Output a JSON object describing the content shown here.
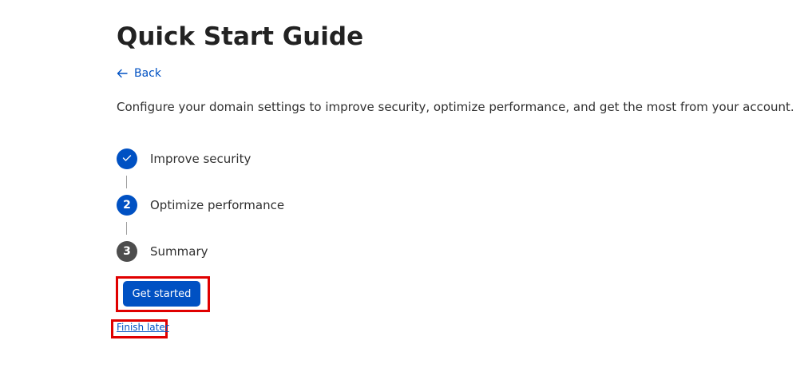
{
  "header": {
    "title": "Quick Start Guide",
    "back_label": "Back"
  },
  "description": "Configure your domain settings to improve security, optimize performance, and get the most from your account.",
  "steps": [
    {
      "marker": "",
      "label": "Improve security",
      "status": "completed",
      "color": "#0051c3",
      "icon": "checkmark-icon"
    },
    {
      "marker": "2",
      "label": "Optimize performance",
      "status": "current",
      "color": "#0051c3"
    },
    {
      "marker": "3",
      "label": "Summary",
      "status": "upcoming",
      "color": "#4d4d4d"
    }
  ],
  "actions": {
    "primary_label": "Get started",
    "secondary_label": "Finish later"
  },
  "colors": {
    "accent": "#0051c3",
    "highlight": "#e00000"
  }
}
